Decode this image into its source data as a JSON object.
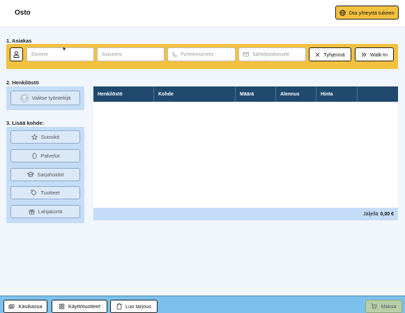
{
  "header": {
    "title": "Osto",
    "support_label": "Ota yhteyttä tukeen"
  },
  "customer": {
    "label": "1. Asiakas",
    "firstname_placeholder": "Etunimi",
    "lastname_placeholder": "Sukunimi",
    "phone_placeholder": "Puhelinnumero",
    "email_placeholder": "Sähköpostiosoite",
    "clear_label": "Tyhjennä",
    "walkin_label": "Walk-In"
  },
  "staff": {
    "label": "2. Henkilöstö",
    "select_label": "Valitse työntekijä"
  },
  "add_item": {
    "label": "3. Lisää kohde:",
    "buttons": [
      {
        "label": "Suosikit",
        "icon": "star-icon"
      },
      {
        "label": "Palvelut",
        "icon": "hand-icon"
      },
      {
        "label": "Sarjahoidot",
        "icon": "graduation-cap-icon"
      },
      {
        "label": "Tuotteet",
        "icon": "tag-icon"
      },
      {
        "label": "Lahjakortit",
        "icon": "gift-icon"
      }
    ]
  },
  "table": {
    "columns": [
      "Henkilöstö",
      "Kohde",
      "Määrä",
      "Alennus",
      "Hinta",
      ""
    ],
    "remaining_label": "Jäljellä",
    "remaining_value": "0,00 €"
  },
  "footer": {
    "cash_label": "Käsikassa",
    "supplies_label": "Käyttötuotteet",
    "quote_label": "Luo tarjous",
    "pay_label": "Maksa"
  },
  "colors": {
    "accent": "#f2c23f",
    "table_header": "#1f4a6e",
    "panel": "#c5dcf6",
    "footer": "#7cc0ec",
    "pay": "#b8cfa9"
  }
}
